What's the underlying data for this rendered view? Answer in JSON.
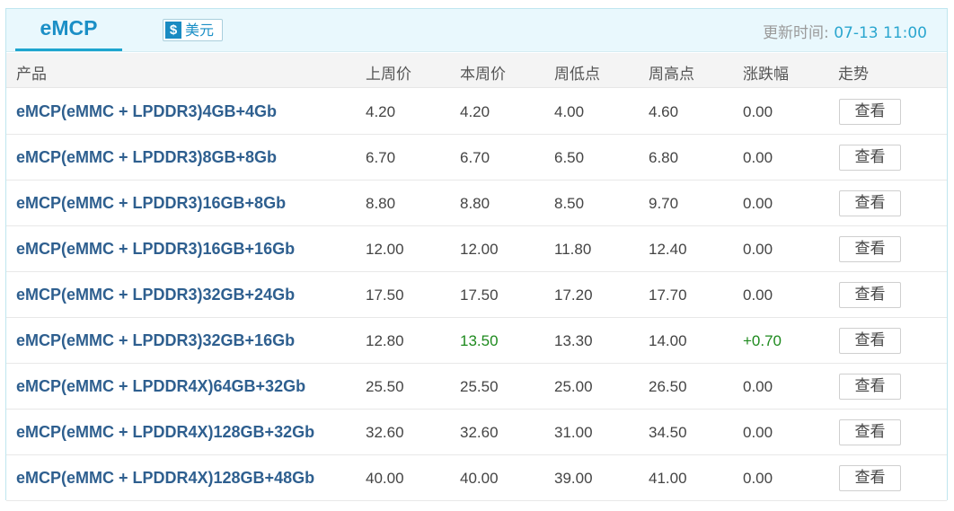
{
  "tabs": {
    "active": "eMCP"
  },
  "currency": {
    "label": "美元",
    "icon": "dollar-icon"
  },
  "update": {
    "prefix": "更新时间: ",
    "time": "07-13 11:00"
  },
  "columns": [
    "产品",
    "上周价",
    "本周价",
    "周低点",
    "周高点",
    "涨跌幅",
    "走势"
  ],
  "view_label": "查看",
  "colors": {
    "accent": "#1b8fc6",
    "up": "#1e8a1e",
    "header_bg": "#e9f8fd"
  },
  "rows": [
    {
      "name": "eMCP(eMMC + LPDDR3)4GB+4Gb",
      "last": "4.20",
      "this": "4.20",
      "low": "4.00",
      "high": "4.60",
      "change": "0.00",
      "up": false
    },
    {
      "name": "eMCP(eMMC + LPDDR3)8GB+8Gb",
      "last": "6.70",
      "this": "6.70",
      "low": "6.50",
      "high": "6.80",
      "change": "0.00",
      "up": false
    },
    {
      "name": "eMCP(eMMC + LPDDR3)16GB+8Gb",
      "last": "8.80",
      "this": "8.80",
      "low": "8.50",
      "high": "9.70",
      "change": "0.00",
      "up": false
    },
    {
      "name": "eMCP(eMMC + LPDDR3)16GB+16Gb",
      "last": "12.00",
      "this": "12.00",
      "low": "11.80",
      "high": "12.40",
      "change": "0.00",
      "up": false
    },
    {
      "name": "eMCP(eMMC + LPDDR3)32GB+24Gb",
      "last": "17.50",
      "this": "17.50",
      "low": "17.20",
      "high": "17.70",
      "change": "0.00",
      "up": false
    },
    {
      "name": "eMCP(eMMC + LPDDR3)32GB+16Gb",
      "last": "12.80",
      "this": "13.50",
      "low": "13.30",
      "high": "14.00",
      "change": "+0.70",
      "up": true
    },
    {
      "name": "eMCP(eMMC + LPDDR4X)64GB+32Gb",
      "last": "25.50",
      "this": "25.50",
      "low": "25.00",
      "high": "26.50",
      "change": "0.00",
      "up": false
    },
    {
      "name": "eMCP(eMMC + LPDDR4X)128GB+32Gb",
      "last": "32.60",
      "this": "32.60",
      "low": "31.00",
      "high": "34.50",
      "change": "0.00",
      "up": false
    },
    {
      "name": "eMCP(eMMC + LPDDR4X)128GB+48Gb",
      "last": "40.00",
      "this": "40.00",
      "low": "39.00",
      "high": "41.00",
      "change": "0.00",
      "up": false
    }
  ]
}
